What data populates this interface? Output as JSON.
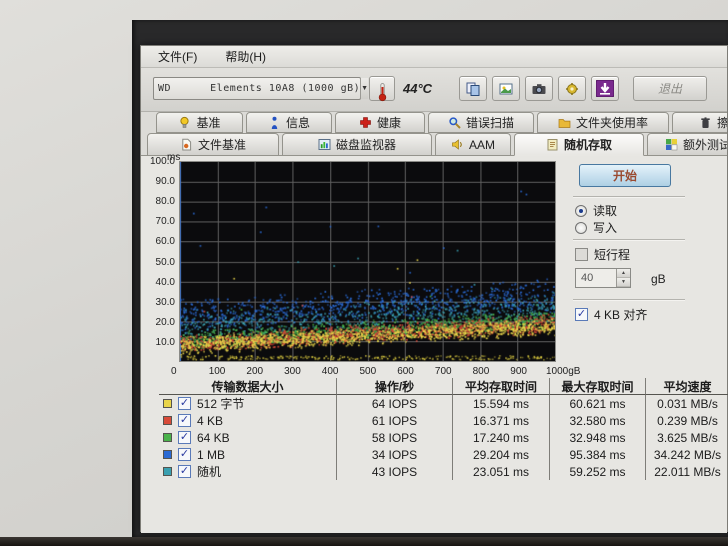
{
  "menu": {
    "items": [
      {
        "label": "文件(F)"
      },
      {
        "label": "帮助(H)"
      }
    ]
  },
  "toolbar": {
    "drive_select": "WD      Elements 10A8 (1000 gB)",
    "temperature": "44°C",
    "exit_label": "退出",
    "icon_buttons": [
      {
        "id": "copy",
        "icon": "copy-icon"
      },
      {
        "id": "save-image",
        "icon": "save-image-icon"
      },
      {
        "id": "screenshot",
        "icon": "camera-icon"
      },
      {
        "id": "options",
        "icon": "options-icon"
      },
      {
        "id": "download",
        "icon": "download-icon"
      }
    ]
  },
  "tabs": {
    "active": "随机存取",
    "row1": [
      {
        "id": "benchmark",
        "label": "基准",
        "icon": "lamp-icon"
      },
      {
        "id": "info",
        "label": "信息",
        "icon": "info-icon"
      },
      {
        "id": "health",
        "label": "健康",
        "icon": "health-cross-icon"
      },
      {
        "id": "error-scan",
        "label": "错误扫描",
        "icon": "magnifier-icon"
      },
      {
        "id": "folder-usage",
        "label": "文件夹使用率",
        "icon": "folder-icon"
      },
      {
        "id": "erase",
        "label": "擦除",
        "icon": "trash-icon"
      }
    ],
    "row2": [
      {
        "id": "file-benchmark",
        "label": "文件基准",
        "icon": "file-doc-icon"
      },
      {
        "id": "disk-monitor",
        "label": "磁盘监视器",
        "icon": "bar-chart-icon"
      },
      {
        "id": "aam",
        "label": "AAM",
        "icon": "speaker-icon"
      },
      {
        "id": "random-access",
        "label": "随机存取",
        "icon": "note-page-icon"
      },
      {
        "id": "extra-tests",
        "label": "额外测试",
        "icon": "tiles-icon"
      }
    ]
  },
  "controls": {
    "start_label": "开始",
    "mode_read": "读取",
    "mode_write": "写入",
    "mode_selected": "读取",
    "short_stroke_label": "短行程",
    "short_stroke_checked": false,
    "capacity_value": "40",
    "capacity_unit": "gB",
    "align_label": "4 KB 对齐",
    "align_checked": true
  },
  "chart_data": {
    "type": "scatter",
    "ylabel_unit": "ms",
    "xlabel_unit": "gB",
    "ylim": [
      0,
      100
    ],
    "xlim": [
      0,
      1000
    ],
    "y_ticks": [
      "100.0",
      "90.0",
      "80.0",
      "70.0",
      "60.0",
      "50.0",
      "40.0",
      "30.0",
      "20.0",
      "10.0"
    ],
    "x_tick_labels": [
      "0",
      "100",
      "200",
      "300",
      "400",
      "500",
      "600",
      "700",
      "800",
      "900",
      "1000gB"
    ],
    "grid": true,
    "plot_bg": "#0b0b0d",
    "grid_color": "#5e5e5e",
    "series": [
      {
        "name": "512 字节",
        "color": "#e8d44a",
        "z": 5,
        "points": 1150,
        "band_start": [
          3,
          13
        ],
        "band_end": [
          13,
          22
        ],
        "outliers": 4,
        "outlier_max": 60
      },
      {
        "name": "4 KB",
        "color": "#d84a38",
        "z": 4,
        "points": 1100,
        "band_start": [
          4,
          14
        ],
        "band_end": [
          14,
          24
        ],
        "outliers": 3,
        "outlier_max": 33
      },
      {
        "name": "64 KB",
        "color": "#4ab24a",
        "z": 3,
        "points": 1100,
        "band_start": [
          5,
          16
        ],
        "band_end": [
          16,
          26
        ],
        "outliers": 3,
        "outlier_max": 33
      },
      {
        "name": "1 MB",
        "color": "#2a6ad4",
        "z": 1,
        "points": 850,
        "band_start": [
          14,
          32
        ],
        "band_end": [
          24,
          42
        ],
        "outliers": 10,
        "outlier_max": 95
      },
      {
        "name": "随机",
        "color": "#3aa0b0",
        "z": 2,
        "points": 650,
        "band_start": [
          8,
          26
        ],
        "band_end": [
          18,
          36
        ],
        "outliers": 6,
        "outlier_max": 59
      }
    ],
    "floor_dots": {
      "color": "#d8c840",
      "points": 260,
      "range": [
        1,
        3
      ]
    }
  },
  "table": {
    "headers": [
      "传输数据大小",
      "操作/秒",
      "平均存取时间",
      "最大存取时间",
      "平均速度"
    ],
    "rows": [
      {
        "swatch": "#e8d44a",
        "checked": true,
        "label": "512 字节",
        "ops": "64 IOPS",
        "avg": "15.594 ms",
        "max": "60.621 ms",
        "speed": "0.031 MB/s"
      },
      {
        "swatch": "#d84a38",
        "checked": true,
        "label": "4 KB",
        "ops": "61 IOPS",
        "avg": "16.371 ms",
        "max": "32.580 ms",
        "speed": "0.239 MB/s"
      },
      {
        "swatch": "#4ab24a",
        "checked": true,
        "label": "64 KB",
        "ops": "58 IOPS",
        "avg": "17.240 ms",
        "max": "32.948 ms",
        "speed": "3.625 MB/s"
      },
      {
        "swatch": "#2a6ad4",
        "checked": true,
        "label": "1 MB",
        "ops": "34 IOPS",
        "avg": "29.204 ms",
        "max": "95.384 ms",
        "speed": "34.242 MB/s"
      },
      {
        "swatch": "#3aa0b0",
        "checked": true,
        "label": "随机",
        "ops": "43 IOPS",
        "avg": "23.051 ms",
        "max": "59.252 ms",
        "speed": "22.011 MB/s"
      }
    ]
  }
}
